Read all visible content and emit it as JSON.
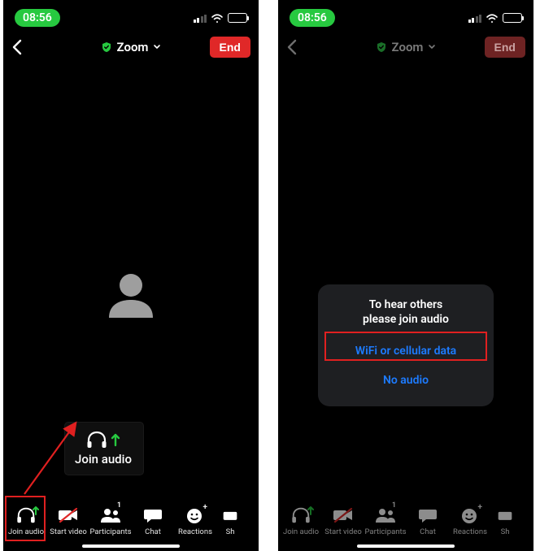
{
  "status": {
    "time": "08:56"
  },
  "header": {
    "title": "Zoom",
    "end_label": "End"
  },
  "tooltip": {
    "label": "Join audio"
  },
  "toolbar": {
    "items": [
      {
        "label": "Join audio"
      },
      {
        "label": "Start video"
      },
      {
        "label": "Participants",
        "badge": "1"
      },
      {
        "label": "Chat"
      },
      {
        "label": "Reactions"
      },
      {
        "label": "Sh"
      }
    ]
  },
  "dialog": {
    "line1": "To hear others",
    "line2": "please join audio",
    "opt_wifi": "WiFi or cellular data",
    "opt_none": "No audio"
  }
}
